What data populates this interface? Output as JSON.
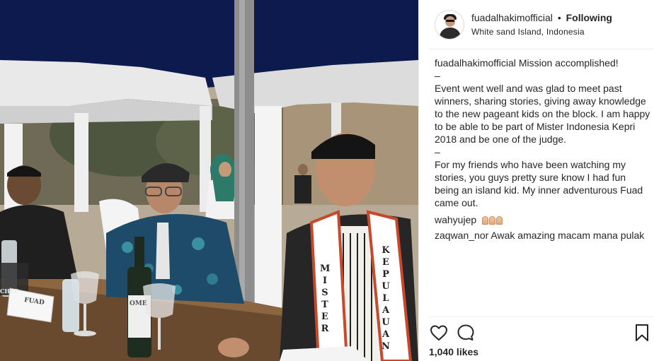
{
  "post": {
    "photo": {
      "description_alt": "",
      "name_card": "FUAD",
      "bottle_label": "OME",
      "glass_label": "CHEE",
      "sash_left": [
        "M",
        "I",
        "S",
        "T",
        "E",
        "R"
      ],
      "sash_right": [
        "K",
        "E",
        "P",
        "U",
        "L",
        "A",
        "U",
        "A",
        "N"
      ]
    },
    "header": {
      "username": "fuadalhakimofficial",
      "separator": "•",
      "follow_label": "Following",
      "location": "White sand Island, Indonesia"
    },
    "caption": {
      "username": "fuadalhakimofficial",
      "text": "Mission accomplished!\n–\nEvent went well and was glad to meet past winners, sharing stories, giving away knowledge to the new pageant kids on the block. I am happy to be able to be part of Mister Indonesia Kepri 2018 and be one of the judge.\n–\nFor my friends who have been watching my stories, you guys pretty sure know I had fun being an island kid. My inner adventurous Fuad came out."
    },
    "comments": [
      {
        "username": "wahyujep",
        "text": "",
        "emoji_count": 3
      },
      {
        "username": "zaqwan_nor",
        "text": "Awak amazing macam mana pulak"
      }
    ],
    "actions": {
      "like_icon": "heart-outline-icon",
      "comment_icon": "speech-bubble-icon",
      "save_icon": "bookmark-outline-icon"
    },
    "likes_text": "1,040 likes"
  }
}
